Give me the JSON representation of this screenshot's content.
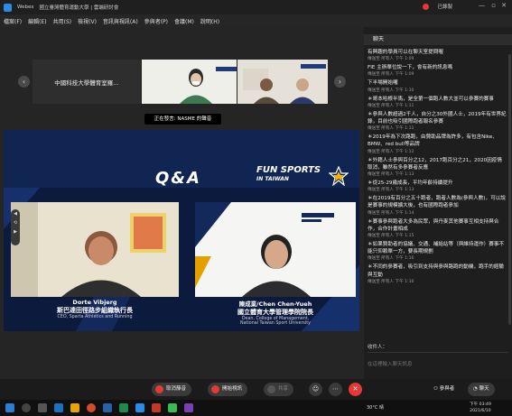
{
  "window": {
    "app_name": "Webex",
    "tab_title": "國立臺灣體育運動大學 | 雲端研討會",
    "recording_label": "已錄製",
    "minimize": "—",
    "close": "✕"
  },
  "menu": [
    "檔案(F)",
    "編輯(E)",
    "共用(S)",
    "檢視(V)",
    "音訊與視訊(A)",
    "參與者(P)",
    "會議(M)",
    "說明(H)"
  ],
  "thumbnails": {
    "participant1": "中國科技大學體育室羅...",
    "participant2": "",
    "participant3": ""
  },
  "speaking_label": "正在發言: NASME 的聲音",
  "stage": {
    "qa_title": "Q&A",
    "brand_line1": "FUN SPORTS",
    "brand_line2": "IN TAIWAN",
    "left_speaker": {
      "name_en": "Dorte Vibjerg",
      "name_zh": "斯巴達田徑路步組織執行長",
      "role": "CEO, Sparta Athletics and Running"
    },
    "right_speaker": {
      "name_en": "陳成業/Chen Chen-Yueh",
      "name_zh": "國立體育大學管理學院院長",
      "role_line1": "Dean, College of Management,",
      "role_line2": "National Taiwan Sport University"
    }
  },
  "controls": {
    "mute": "取消靜音",
    "video": "開始視訊",
    "share": "共享",
    "participants": "參與者",
    "chat": "聊天"
  },
  "chat": {
    "header": "聊天",
    "to_label": "收件人：",
    "input_placeholder": "在這裡輸入聊天訊息",
    "messages": [
      {
        "text": "有興趣的學員可以在聊天室提問喔",
        "meta": "傳送至 所有人 下午 1:09"
      },
      {
        "text": "FIE 主辦單位說一下，會有新的訊息嗎",
        "meta": "傳送至 所有人 下午 1:09"
      },
      {
        "text": "下半場開始囉",
        "meta": "傳送至 所有人 下午 1:10"
      },
      {
        "text": "＊哥本哈根半馬，是全第一個跑人數大並可以參賽的賽事",
        "meta": "傳送至 所有人 下午 1:11"
      },
      {
        "text": "＊參與人數超過2千人，自分之30外國人士，2019年有世界紀錄，目前也吸引國際跑者報名參賽",
        "meta": "傳送至 所有人 下午 1:11"
      },
      {
        "text": "＊2019年為下次路跑，由贊助品牌為許多，有包含Nike、BMW、red bull等品牌",
        "meta": "傳送至 所有人 下午 1:12"
      },
      {
        "text": "＊外籍人士參與百分之12，2017跑百分之21，2020因疫情取消，雖然有多參賽者反應",
        "meta": "傳送至 所有人 下午 1:13"
      },
      {
        "text": "＊從25-29歲成長，平均年齡持續提升",
        "meta": "傳送至 所有人 下午 1:13"
      },
      {
        "text": "＊在2019有百分之五十跑者，跑者人數為(參與人數)，可以說是賽事的規模擴大後，也有國際跑者參加",
        "meta": "傳送至 所有人 下午 1:14"
      },
      {
        "text": "＊賽事參與跑者大多為民眾，與丹麥其他賽事互相支持與合作，合作計畫相成",
        "meta": "傳送至 所有人 下午 1:15"
      },
      {
        "text": "＊如果贊助者的協議、交通、補給站等（與維持運作）賽事不能只仰賴單一方，要長期規劃",
        "meta": "傳送至 所有人 下午 1:16"
      },
      {
        "text": "＊不同的參賽者，吸引到支持與參與路跑的動機，跑手的經驗與互動",
        "meta": "傳送至 所有人 下午 1:16"
      }
    ]
  },
  "taskbar": {
    "temperature": "30°C 晴",
    "time": "下午 03:49",
    "date": "2021/6/10"
  },
  "colors": {
    "accent_red": "#e53935",
    "stage_navy": "#0c1a3d",
    "panel_dark": "#1e1e1e"
  }
}
